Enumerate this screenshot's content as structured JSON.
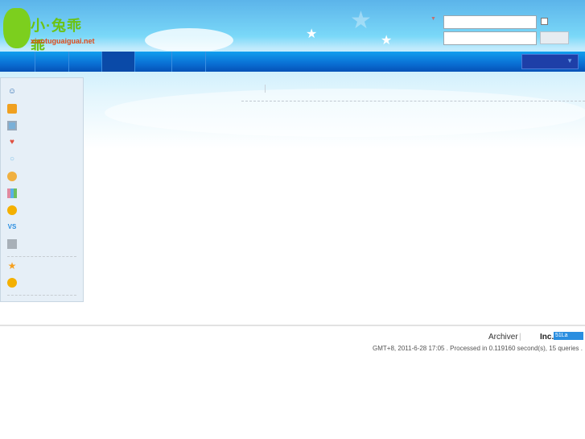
{
  "header": {
    "logo_title": "小·兔乖乖",
    "logo_domain": "xiaotuguaiguai.net",
    "login": {
      "username_value": "",
      "password_value": "",
      "remember_checked": false
    }
  },
  "nav": {
    "active_index": 3
  },
  "sidebar": {
    "icons": [
      "profile-icon",
      "notebook-icon",
      "photo-icon",
      "heart-icon",
      "chat-bubble-icon",
      "group-icon",
      "chart-icon",
      "gold-ingot-icon",
      "vs-icon",
      "cart-icon",
      "star-icon",
      "gold-ingot-icon"
    ],
    "vs_label": "VS"
  },
  "footer": {
    "archiver": "Archiver",
    "separator": "|",
    "inc": "Inc.",
    "badge": "51La",
    "debug": "GMT+8, 2011-6-28 17:05 . Processed in 0.119160 second(s), 15 queries ."
  },
  "colors": {
    "nav": "#0a6fd4",
    "sidebar": "#e6eff7",
    "logo": "#6cc312"
  }
}
